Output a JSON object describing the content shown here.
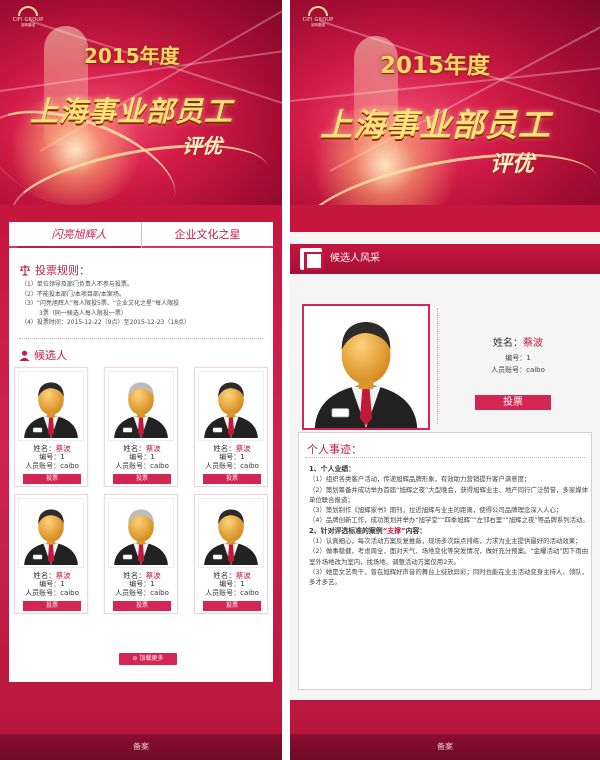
{
  "brand": {
    "logo_text": "CIFI GROUP",
    "logo_sub": "旭辉集团"
  },
  "banner": {
    "year": "2015年度",
    "title": "上海事业部员工",
    "subtitle": "评优"
  },
  "left": {
    "tabs": [
      {
        "label": "闪亮旭辉人",
        "active": true
      },
      {
        "label": "企业文化之星",
        "active": false
      }
    ],
    "rules": {
      "heading": "投票规则：",
      "lines": [
        "（1）单位领导及部门负责人不参与投票。",
        "（2）不能投本部门/本项目部/本案场。",
        "（3）“闪亮旭辉人”每人限投5票、“企业文化之星”每人限投",
        "3票（同一候选人每人限投一票）",
        "（4）投票时间：2015-12-22（9点）至2015-12-23（18点）"
      ]
    },
    "candidates_heading": "候选人",
    "candidates": [
      {
        "name_label": "姓名：",
        "name": "蔡波",
        "number": "编号：1",
        "account": "人员账号：caibo",
        "vote": "投票",
        "hair": "dark"
      },
      {
        "name_label": "姓名：",
        "name": "蔡波",
        "number": "编号：1",
        "account": "人员账号：caibo",
        "vote": "投票",
        "hair": "gray"
      },
      {
        "name_label": "姓名：",
        "name": "蔡波",
        "number": "编号：1",
        "account": "人员账号：caibo",
        "vote": "投票",
        "hair": "dark"
      },
      {
        "name_label": "姓名：",
        "name": "蔡波",
        "number": "编号：1",
        "account": "人员账号：caibo",
        "vote": "投票",
        "hair": "dark"
      },
      {
        "name_label": "姓名：",
        "name": "蔡波",
        "number": "编号：1",
        "account": "人员账号：caibo",
        "vote": "投票",
        "hair": "gray"
      },
      {
        "name_label": "姓名：",
        "name": "蔡波",
        "number": "编号：1",
        "account": "人员账号：caibo",
        "vote": "投票",
        "hair": "dark"
      }
    ],
    "load_more": "加载更多",
    "footer": "备案"
  },
  "right": {
    "header": "候选人风采",
    "profile": {
      "name_label": "姓名：",
      "name": "蔡波",
      "number": "编号：1",
      "account": "人员账号：caibo",
      "vote": "投票"
    },
    "deeds": {
      "heading": "个人事迹：",
      "items": [
        {
          "type": "title",
          "text": "1、个人业绩："
        },
        {
          "type": "para",
          "text": "（1）组织各类客户活动，传递旭辉品牌形象，有效助力营销提升客户满意度；"
        },
        {
          "type": "para",
          "text": "（2）策划筹备并成功举办首届“旭辉之夜”大型晚会，获得旭辉业主、地产同行广泛赞誉，多家媒体单位联合报道；"
        },
        {
          "type": "para",
          "text": "（3）策划制作《旭辉家书》期刊，拉近旭辉与业主的距离，使得公司品牌理念深入人心；"
        },
        {
          "type": "para",
          "text": "（4）品牌创新工作，成功策划并举办“旭学堂”“四季旭辉”“左邻右里”“旭辉之夜”等品牌系列活动。"
        },
        {
          "type": "title2",
          "prefix": "2、针对评选标准的案例",
          "quote": "“支撑”",
          "suffix": "内容："
        },
        {
          "type": "para",
          "text": "（1）认真细心，每次活动方案反复推敲，现场多次踩点排练，力求为业主提供最好的活动效果；"
        },
        {
          "type": "para",
          "text": "（2）做事稳健，考虑周全，面对天气、场地变化等突发情况，做好充分预案。“金耀活动”因下雨由室外场地改为室内，找场地、调整活动方案仅用2天。"
        },
        {
          "type": "para",
          "text": "（3）她是文艺骨干，曾在旭辉好声音的舞台上绽放异彩；同时也能在业主活动变身主持人、领队，多才多艺。"
        }
      ]
    },
    "footer": "备案"
  }
}
